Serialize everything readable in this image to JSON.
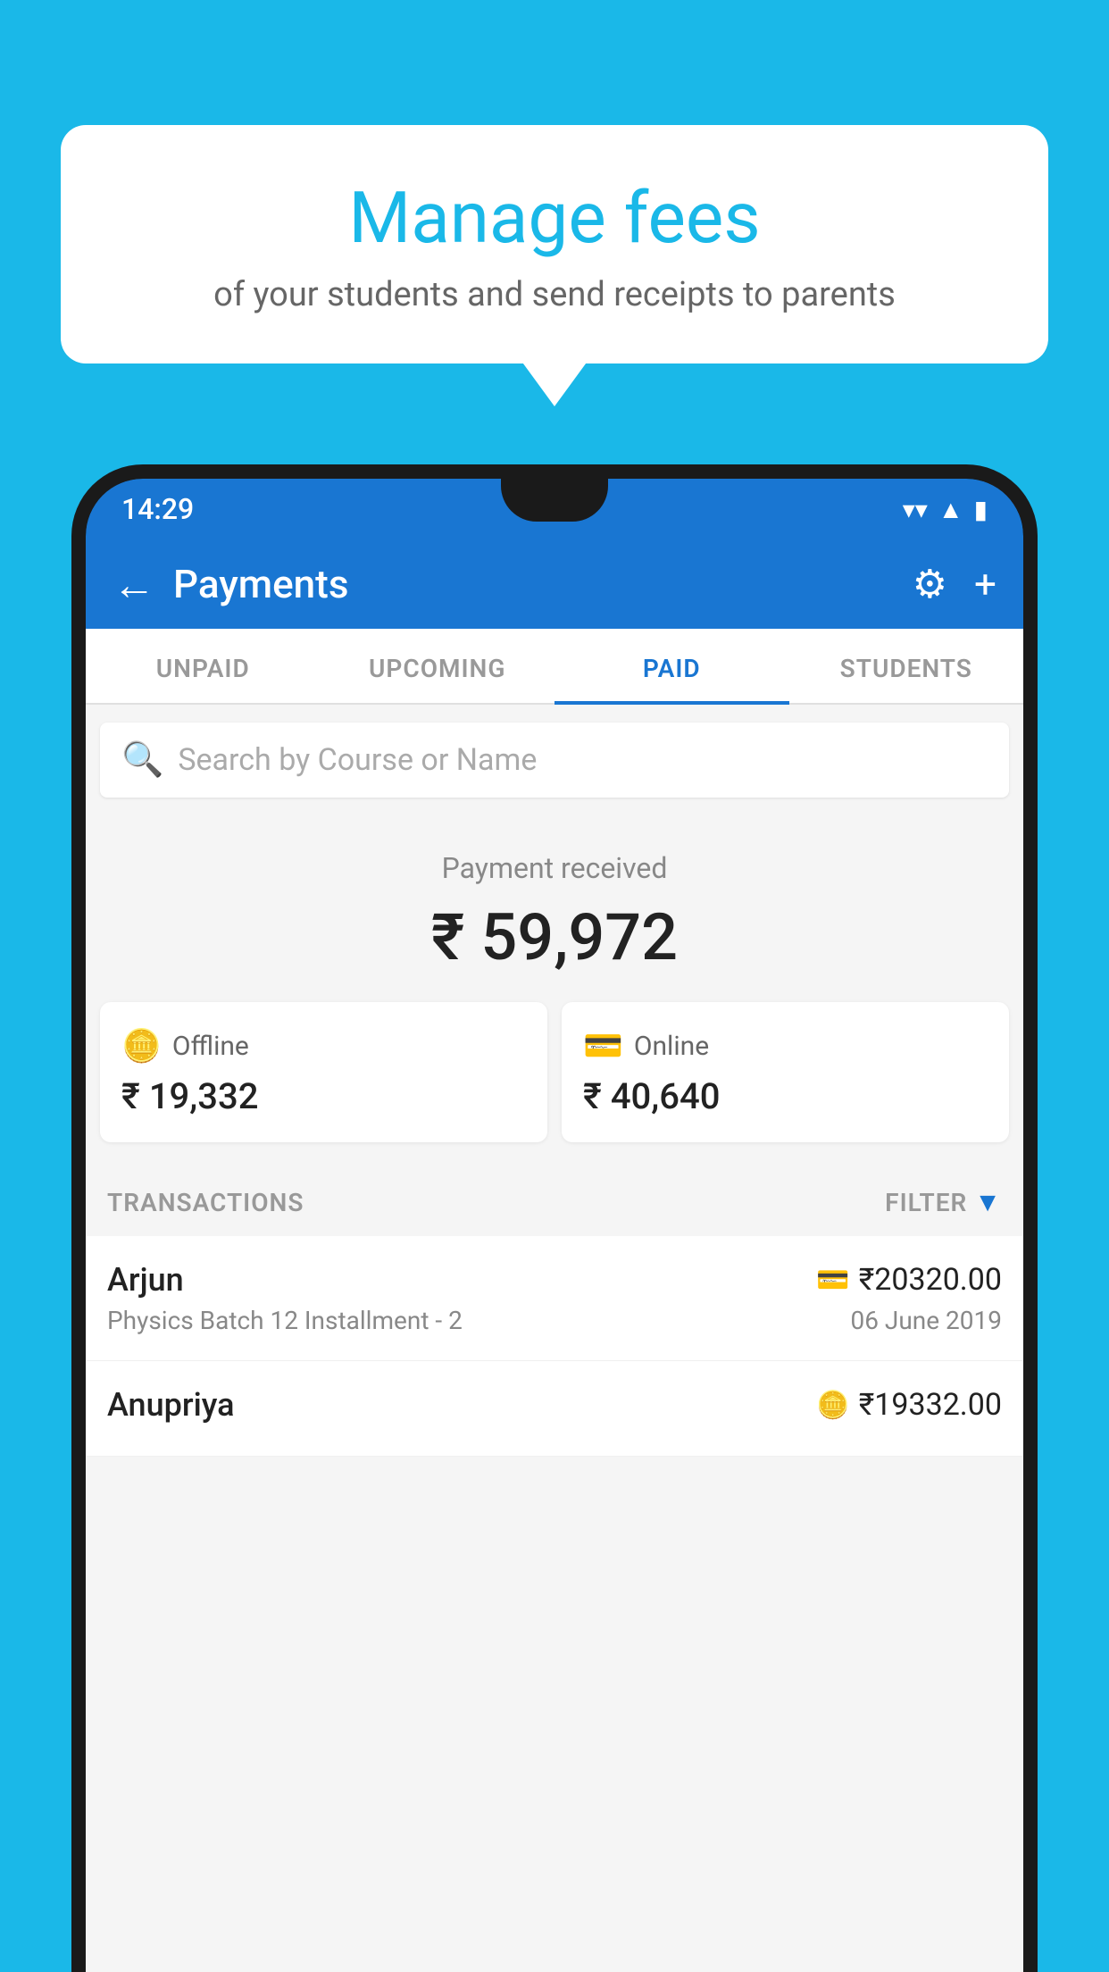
{
  "background_color": "#1ab8e8",
  "speech_bubble": {
    "title": "Manage fees",
    "subtitle": "of your students and send receipts to parents"
  },
  "status_bar": {
    "time": "14:29",
    "wifi_icon": "wifi-icon",
    "signal_icon": "signal-icon",
    "battery_icon": "battery-icon"
  },
  "app_bar": {
    "back_icon": "back-arrow-icon",
    "title": "Payments",
    "settings_icon": "settings-icon",
    "add_icon": "add-icon"
  },
  "tabs": [
    {
      "label": "UNPAID",
      "active": false
    },
    {
      "label": "UPCOMING",
      "active": false
    },
    {
      "label": "PAID",
      "active": true
    },
    {
      "label": "STUDENTS",
      "active": false
    }
  ],
  "search": {
    "placeholder": "Search by Course or Name"
  },
  "payment_received": {
    "label": "Payment received",
    "amount": "₹ 59,972"
  },
  "payment_cards": {
    "offline": {
      "icon": "offline-payment-icon",
      "label": "Offline",
      "amount": "₹ 19,332"
    },
    "online": {
      "icon": "online-payment-icon",
      "label": "Online",
      "amount": "₹ 40,640"
    }
  },
  "transactions": {
    "header": "TRANSACTIONS",
    "filter_label": "FILTER",
    "filter_icon": "filter-icon",
    "items": [
      {
        "name": "Arjun",
        "amount": "₹20320.00",
        "payment_type_icon": "card-payment-icon",
        "course": "Physics Batch 12 Installment - 2",
        "date": "06 June 2019"
      },
      {
        "name": "Anupriya",
        "amount": "₹19332.00",
        "payment_type_icon": "cash-payment-icon",
        "course": "",
        "date": ""
      }
    ]
  }
}
